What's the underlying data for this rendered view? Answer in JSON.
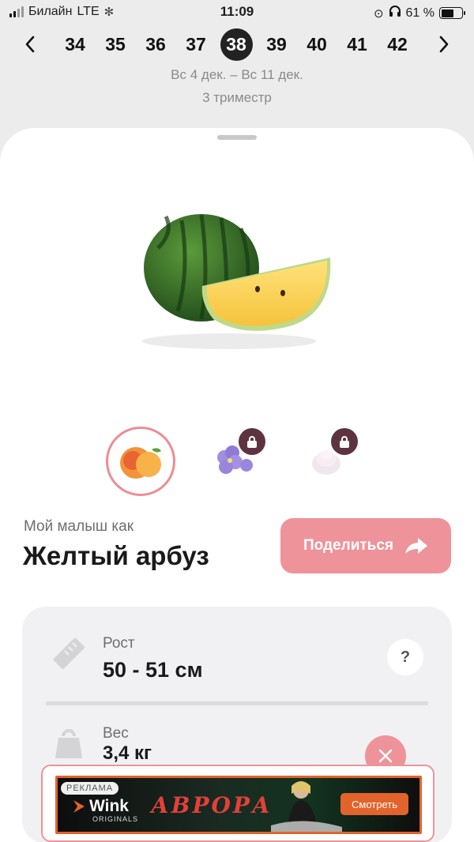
{
  "status_bar": {
    "carrier": "Билайн",
    "network": "LTE",
    "time": "11:09",
    "battery_text": "61 %",
    "battery_level": 0.61
  },
  "week_nav": {
    "weeks": [
      "34",
      "35",
      "36",
      "37",
      "38",
      "39",
      "40",
      "41",
      "42"
    ],
    "active_week": "38",
    "date_range": "Вс 4 дек. – Вс 11 дек.",
    "trimester": "3 триместр"
  },
  "baby": {
    "subtitle": "Мой малыш как",
    "title": "Желтый арбуз",
    "share_label": "Поделиться",
    "thumbnails": [
      {
        "icon": "peach-icon",
        "locked": false
      },
      {
        "icon": "violet-flower-icon",
        "locked": true
      },
      {
        "icon": "marshmallow-icon",
        "locked": true
      }
    ]
  },
  "stats": {
    "height_label": "Рост",
    "height_value": "50 - 51 см",
    "help_label": "?",
    "weight_label": "Вес",
    "weight_value": "3,4 кг"
  },
  "ad": {
    "tag": "РЕКЛАМА",
    "brand": "Wink",
    "brand_sub": "ORIGINALS",
    "headline": "АВРОРА",
    "cta": "Смотреть"
  },
  "colors": {
    "accent": "#ef939a",
    "active_week": "#222222",
    "lock": "#5e3340",
    "ad_orange": "#e2632b"
  }
}
